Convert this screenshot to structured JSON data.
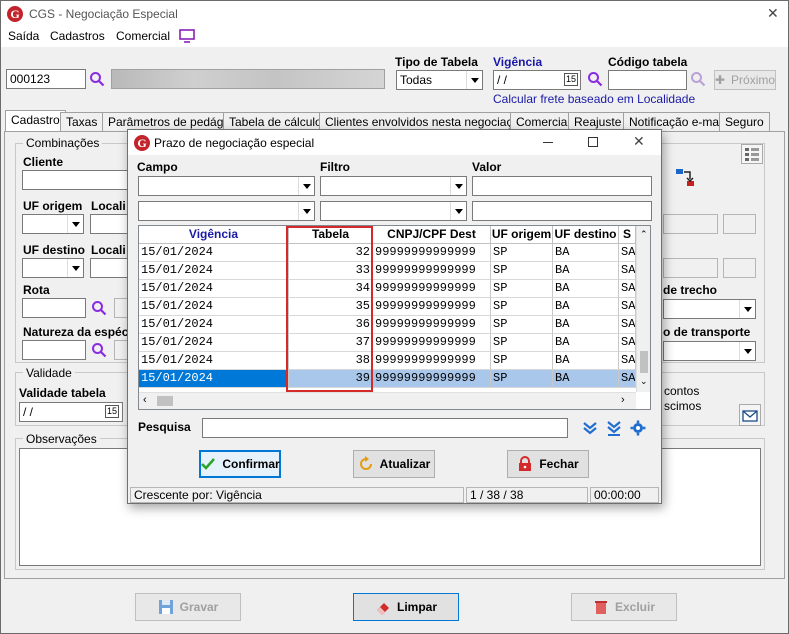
{
  "window": {
    "title": "CGS - Negociação Especial"
  },
  "menu": [
    "Saída",
    "Cadastros",
    "Comercial"
  ],
  "header": {
    "code_value": "000123",
    "tipo_tabela_label": "Tipo de Tabela",
    "tipo_tabela_value": "Todas",
    "vigencia_label": "Vigência",
    "vigencia_value": " / /",
    "codigo_tabela_label": "Código tabela",
    "proximo_label": "Próximo",
    "calc_note": "Calcular frete baseado em Localidade"
  },
  "tabs": [
    "Cadastro",
    "Taxas",
    "Parâmetros de pedágio",
    "Tabela de cálculo",
    "Clientes envolvidos nesta negociação",
    "Comercial",
    "Reajuste",
    "Notificação e-mail",
    "Seguro"
  ],
  "form": {
    "combinacoes_label": "Combinações",
    "cliente_label": "Cliente",
    "uf_origem_label": "UF origem",
    "localidade_origem_label": "Locali",
    "uf_destino_label": "UF destino",
    "localidade_destino_label": "Locali",
    "rota_label": "Rota",
    "natureza_label": "Natureza da espéc",
    "trecho_label": "de trecho",
    "transporte_label": "o de transporte",
    "validade_group": "Validade",
    "validade_tabela_label": "Validade tabela",
    "validade_tabela_value": " / /",
    "contos_label": "contos",
    "scimos_label": "scimos",
    "observacoes_label": "Observações"
  },
  "buttons": {
    "gravar": "Gravar",
    "limpar": "Limpar",
    "excluir": "Excluir"
  },
  "dialog": {
    "title": "Prazo de negociação especial",
    "campo_label": "Campo",
    "filtro_label": "Filtro",
    "valor_label": "Valor",
    "columns": [
      "Vigência",
      "Tabela",
      "CNPJ/CPF Dest",
      "UF origem",
      "UF destino",
      "S"
    ],
    "rows": [
      [
        "15/01/2024",
        "32",
        "99999999999999",
        "SP",
        "BA",
        "SA"
      ],
      [
        "15/01/2024",
        "33",
        "99999999999999",
        "SP",
        "BA",
        "SA"
      ],
      [
        "15/01/2024",
        "34",
        "99999999999999",
        "SP",
        "BA",
        "SA"
      ],
      [
        "15/01/2024",
        "35",
        "99999999999999",
        "SP",
        "BA",
        "SA"
      ],
      [
        "15/01/2024",
        "36",
        "99999999999999",
        "SP",
        "BA",
        "SA"
      ],
      [
        "15/01/2024",
        "37",
        "99999999999999",
        "SP",
        "BA",
        "SA"
      ],
      [
        "15/01/2024",
        "38",
        "99999999999999",
        "SP",
        "BA",
        "SA"
      ],
      [
        "15/01/2024",
        "39",
        "99999999999999",
        "SP",
        "BA",
        "SA"
      ]
    ],
    "pesquisa_label": "Pesquisa",
    "confirmar": "Confirmar",
    "atualizar": "Atualizar",
    "fechar": "Fechar",
    "status_sort": "Crescente por: Vigência",
    "status_count": "1 / 38 / 38",
    "status_time": "00:00:00"
  },
  "colors": {
    "accent_blue": "#1a1aa6",
    "selection": "#0078d7",
    "highlight_box": "#d42a2a",
    "logo_red": "#c3232a"
  }
}
